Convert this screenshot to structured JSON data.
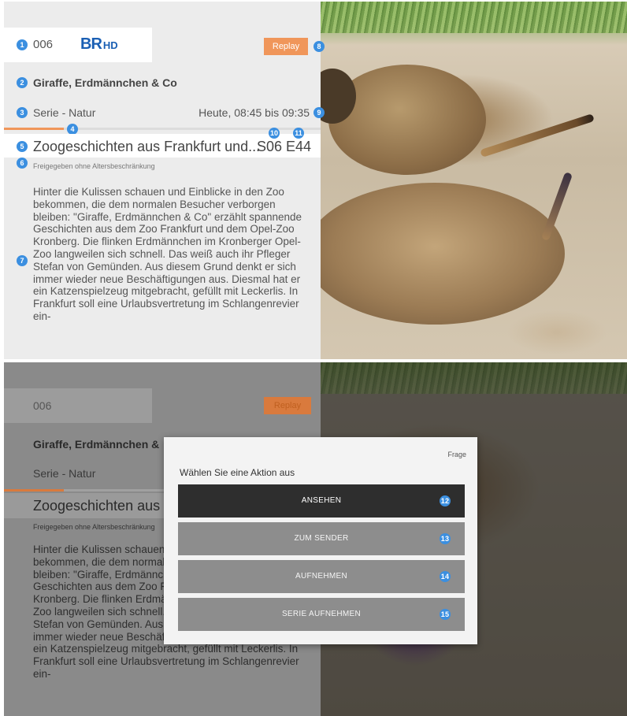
{
  "badges": {
    "b1": "1",
    "b2": "2",
    "b3": "3",
    "b4": "4",
    "b5": "5",
    "b6": "6",
    "b7": "7",
    "b8": "8",
    "b9": "9",
    "b10": "10",
    "b11": "11",
    "b12": "12",
    "b13": "13",
    "b14": "14",
    "b15": "15"
  },
  "channel": {
    "number": "006",
    "logo_text": "BR",
    "logo_suffix": "HD"
  },
  "replay_label": "Replay",
  "program": {
    "title": "Giraffe, Erdmännchen & Co",
    "genre": "Serie - Natur",
    "airtime": "Heute, 08:45 bis 09:35",
    "progress": 0.19,
    "episode_title": "Zoogeschichten aus Frankfurt und...",
    "episode_code": "S06 E44",
    "rating": "Freigegeben ohne Altersbeschränkung",
    "description": "Hinter die Kulissen schauen und Einblicke in den Zoo bekommen, die dem normalen Besucher verborgen bleiben: \"Giraffe, Erdmännchen & Co\" erzählt spannende Geschichten aus dem Zoo Frankfurt und dem Opel-Zoo Kronberg. Die flinken Erdmännchen im Kronberger Opel-Zoo langweilen sich schnell. Das weiß auch ihr Pfleger Stefan von Gemünden. Aus diesem Grund denkt er sich immer wieder neue Beschäftigungen aus. Diesmal hat er ein Katzenspielzeug mitgebracht, gefüllt mit Leckerlis. In Frankfurt soll eine Urlaubsvertretung im Schlangenrevier ein-"
  },
  "bottom": {
    "title_partial": "Giraffe, Erdmännchen &",
    "episode_partial": "Zoogeschichten aus",
    "rating_partial": "Freigegeben ohne Altersbeschränkung"
  },
  "dialog": {
    "kind": "Frage",
    "title": "Wählen Sie eine Aktion aus",
    "actions": [
      "ANSEHEN",
      "ZUM SENDER",
      "AUFNEHMEN",
      "SERIE AUFNEHMEN"
    ]
  },
  "colors": {
    "accent": "#f0965a",
    "badge": "#3b8fe0",
    "selected": "#2e2e2e"
  }
}
